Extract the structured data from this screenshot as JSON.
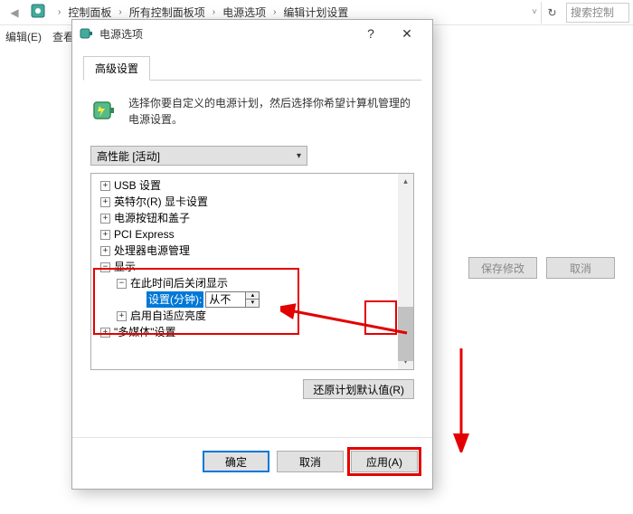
{
  "breadcrumb": {
    "items": [
      "控制面板",
      "所有控制面板项",
      "电源选项",
      "编辑计划设置"
    ]
  },
  "menu": {
    "edit": "编辑(E)",
    "view": "查看"
  },
  "search": {
    "placeholder": "搜索控制"
  },
  "side": {
    "save": "保存修改",
    "cancel": "取消"
  },
  "dialog": {
    "title": "电源选项",
    "tab": "高级设置",
    "description": "选择你要自定义的电源计划，然后选择你希望计算机管理的电源设置。",
    "plan": "高性能 [活动]",
    "tree": {
      "items": [
        {
          "exp": "+",
          "label": "USB 设置",
          "indent": 0
        },
        {
          "exp": "+",
          "label": "英特尔(R) 显卡设置",
          "indent": 0
        },
        {
          "exp": "+",
          "label": "电源按钮和盖子",
          "indent": 0
        },
        {
          "exp": "+",
          "label": "PCI Express",
          "indent": 0
        },
        {
          "exp": "+",
          "label": "处理器电源管理",
          "indent": 0
        },
        {
          "exp": "−",
          "label": "显示",
          "indent": 0
        },
        {
          "exp": "−",
          "label": "在此时间后关闭显示",
          "indent": 1
        },
        {
          "exp": "",
          "label": "设置(分钟):",
          "value": "从不",
          "indent": 2,
          "setting": true
        },
        {
          "exp": "+",
          "label": "启用自适应亮度",
          "indent": 1
        },
        {
          "exp": "+",
          "label": "\"多媒体\"设置",
          "indent": 0
        }
      ]
    },
    "restore": "还原计划默认值(R)",
    "ok": "确定",
    "cancel": "取消",
    "apply": "应用(A)"
  }
}
